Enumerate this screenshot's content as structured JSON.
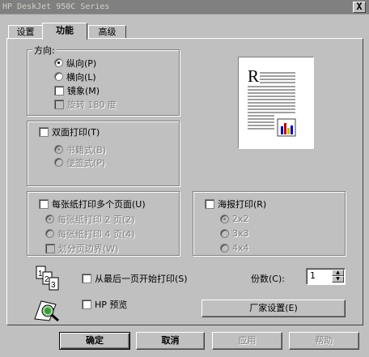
{
  "window": {
    "title": "HP DeskJet 950C Series",
    "close_label": "X"
  },
  "tabs": [
    {
      "label": "设置"
    },
    {
      "label": "功能"
    },
    {
      "label": "高级"
    }
  ],
  "orientation": {
    "label": "方向:",
    "portrait": "纵向(P)",
    "landscape": "横向(L)",
    "mirror": "镜象(M)",
    "rotate": "旋转 180 度"
  },
  "duplex": {
    "label": "双面打印(T)",
    "book": "书籍式(B)",
    "tablet": "便签式(P)"
  },
  "pages_per_sheet": {
    "label": "每张纸打印多个页面(U)",
    "two": "每张纸打印 2 页(2)",
    "four": "每张纸打印 4 页(4)",
    "borders": "划分页边界(W)"
  },
  "poster": {
    "label": "海报打印(R)",
    "options": [
      "2x2",
      "3x3",
      "4x4"
    ]
  },
  "back_to_front": "从最后一页开始打印(S)",
  "hp_preview": "HP 预览",
  "copies": {
    "label": "份数(C):",
    "value": "1"
  },
  "defaults_button": "厂家设置(E)",
  "buttons": {
    "ok": "确定",
    "cancel": "取消",
    "apply": "应用",
    "help": "帮助"
  },
  "preview_letter": "R"
}
